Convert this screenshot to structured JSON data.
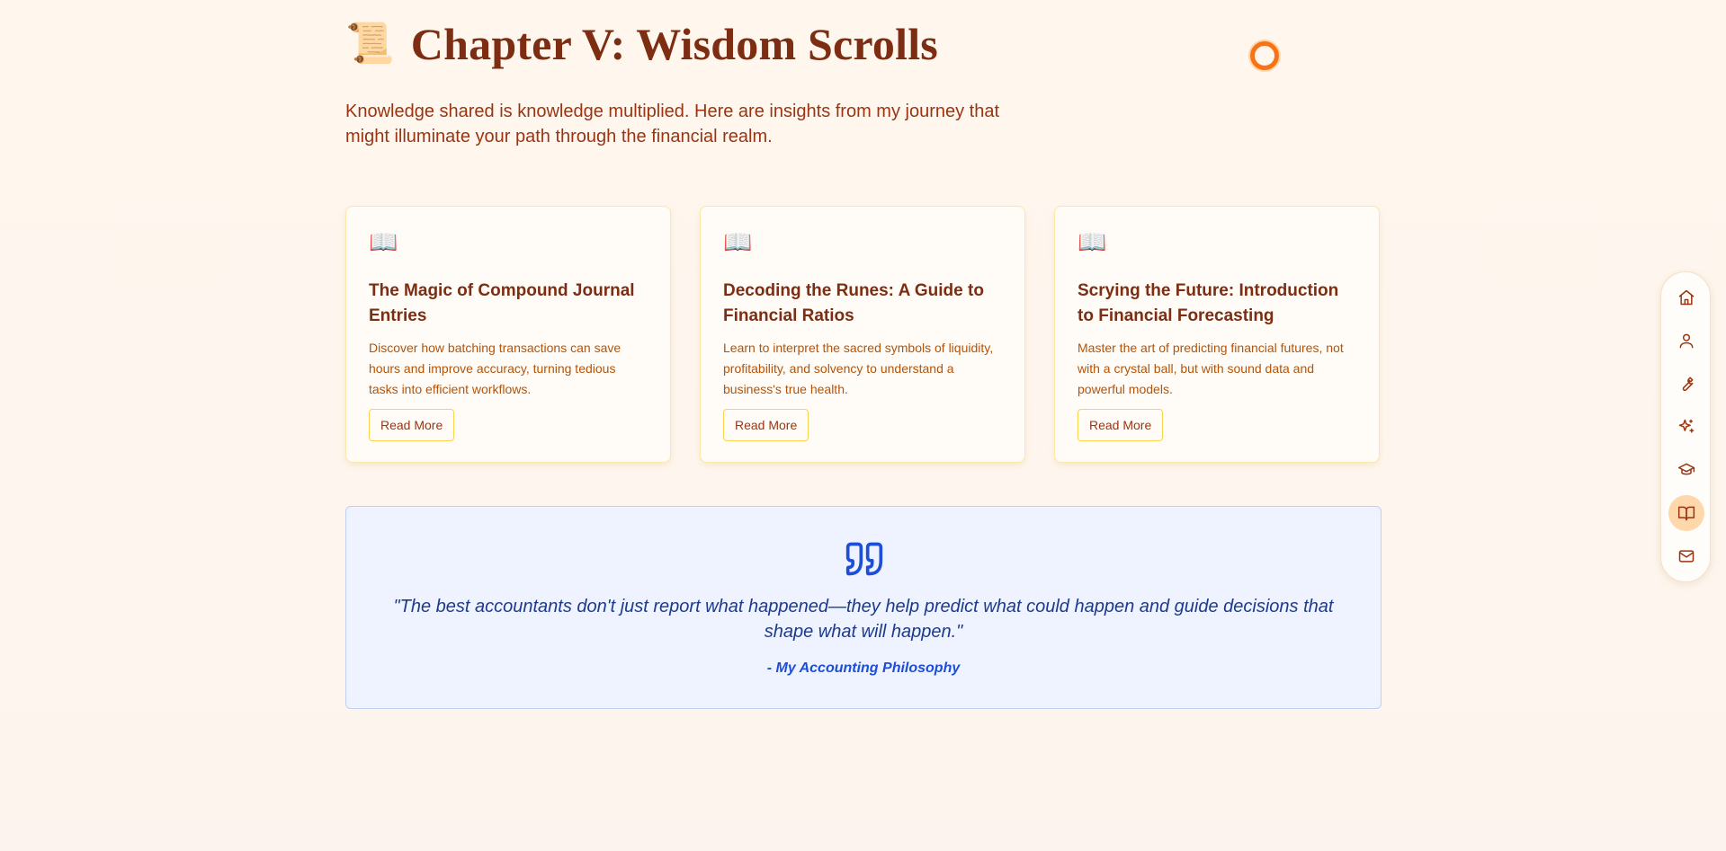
{
  "header": {
    "title_icon": "scroll-icon",
    "title": "Chapter V: Wisdom Scrolls",
    "intro": "Knowledge shared is knowledge multiplied. Here are insights from my journey that might illuminate your path through the financial realm."
  },
  "cards": [
    {
      "icon": "open-book-icon",
      "title": "The Magic of Compound Journal Entries",
      "description": "Discover how batching transactions can save hours and improve accuracy, turning tedious tasks into efficient workflows.",
      "button": "Read More"
    },
    {
      "icon": "open-book-icon",
      "title": "Decoding the Runes: A Guide to Financial Ratios",
      "description": "Learn to interpret the sacred symbols of liquidity, profitability, and solvency to understand a business's true health.",
      "button": "Read More"
    },
    {
      "icon": "open-book-icon",
      "title": "Scrying the Future: Introduction to Financial Forecasting",
      "description": "Master the art of predicting financial futures, not with a crystal ball, but with sound data and powerful models.",
      "button": "Read More"
    }
  ],
  "quote": {
    "icon": "quote-icon",
    "text": "\"The best accountants don't just report what happened—they help predict what could happen and guide decisions that shape what will happen.\"",
    "author": "- My Accounting Philosophy"
  },
  "side_nav": {
    "items": [
      {
        "icon": "home-icon",
        "active": false
      },
      {
        "icon": "user-icon",
        "active": false
      },
      {
        "icon": "wrench-icon",
        "active": false
      },
      {
        "icon": "sparkles-icon",
        "active": false
      },
      {
        "icon": "graduation-cap-icon",
        "active": false
      },
      {
        "icon": "book-open-icon",
        "active": true
      },
      {
        "icon": "mail-icon",
        "active": false
      }
    ]
  },
  "colors": {
    "background": "#fff7ee",
    "heading": "#7c2d12",
    "body_text": "#9a3412",
    "accent_orange": "#f97316",
    "card_border": "#fde7a8",
    "quote_background": "#eef3ff",
    "quote_text": "#1e3a8a",
    "quote_accent": "#1d4ed8",
    "nav_active": "#fed7aa"
  }
}
